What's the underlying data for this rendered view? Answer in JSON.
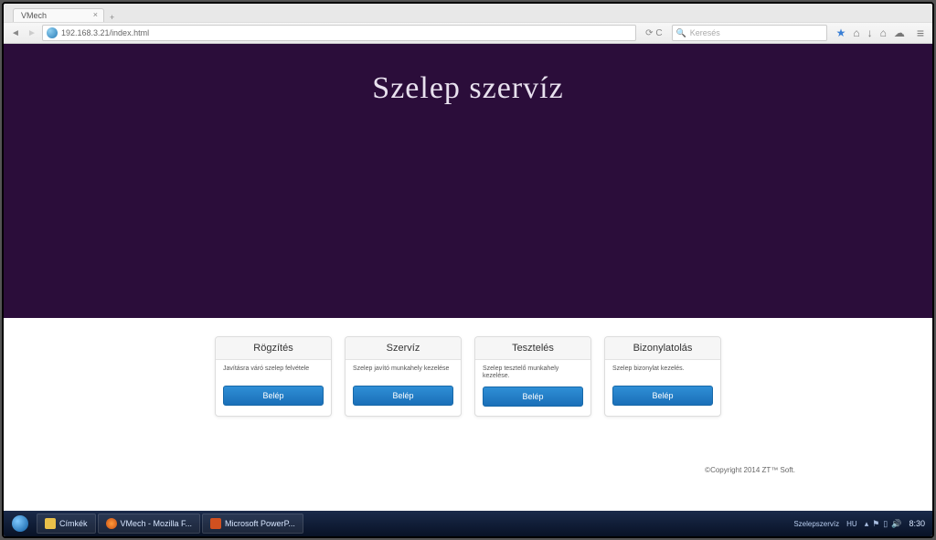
{
  "browser": {
    "tab_title": "VMech",
    "url": "192.168.3.21/index.html",
    "search_placeholder": "Keresés"
  },
  "hero": {
    "title": "Szelep szervíz"
  },
  "cards": [
    {
      "title": "Rögzítés",
      "desc": "Javításra váró szelep felvétele",
      "button": "Belép"
    },
    {
      "title": "Szervíz",
      "desc": "Szelep javító munkahely kezelése",
      "button": "Belép"
    },
    {
      "title": "Tesztelés",
      "desc": "Szelep tesztelő munkahely kezelése.",
      "button": "Belép"
    },
    {
      "title": "Bizonylatolás",
      "desc": "Szelep bizonylat kezelés.",
      "button": "Belép"
    }
  ],
  "footer": {
    "copyright": "©Copyright 2014 ZT™ Soft."
  },
  "taskbar": {
    "items": [
      {
        "label": "Címkék"
      },
      {
        "label": "VMech - Mozilla F..."
      },
      {
        "label": "Microsoft PowerP..."
      }
    ],
    "tray_app": "Szelepszervíz",
    "lang": "HU",
    "time": "8:30"
  }
}
